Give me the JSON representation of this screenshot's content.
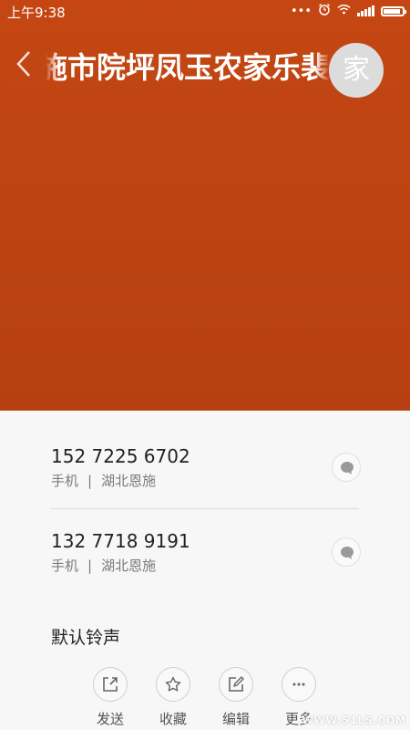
{
  "status_bar": {
    "time": "上午9:38",
    "icons": [
      "more-dots-icon",
      "alarm-icon",
      "wifi-icon",
      "signal-icon",
      "battery-icon"
    ],
    "battery_level_pct": 90
  },
  "header": {
    "title": "恩施市院坪凤玉农家乐裴",
    "avatar_char": "家",
    "background_color": "#bf4513"
  },
  "phones": [
    {
      "number": "152 7225 6702",
      "type": "手机",
      "location": "湖北恩施",
      "separator": "|"
    },
    {
      "number": "132 7718 9191",
      "type": "手机",
      "location": "湖北恩施",
      "separator": "|"
    }
  ],
  "ringtone": {
    "label": "默认铃声"
  },
  "actions": [
    {
      "label": "发送",
      "icon": "share-icon"
    },
    {
      "label": "收藏",
      "icon": "star-icon"
    },
    {
      "label": "编辑",
      "icon": "edit-icon"
    },
    {
      "label": "更多",
      "icon": "more-icon"
    }
  ],
  "watermark": "WWW.51LS.COM"
}
